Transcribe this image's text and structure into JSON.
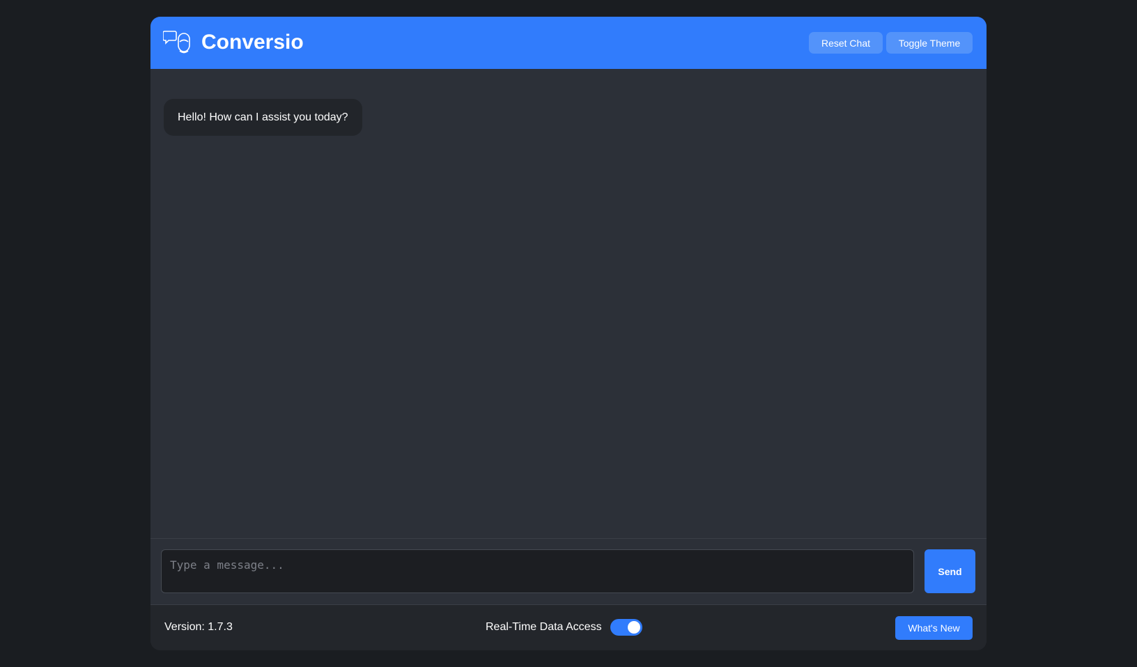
{
  "header": {
    "title": "Conversio",
    "logo_icon": "chat-faces-icon",
    "reset_label": "Reset Chat",
    "theme_label": "Toggle Theme"
  },
  "messages": [
    {
      "sender": "bot",
      "text": "Hello! How can I assist you today?"
    }
  ],
  "composer": {
    "placeholder": "Type a message...",
    "value": "",
    "send_label": "Send"
  },
  "footer": {
    "version_text": "Version: 1.7.3",
    "realtime_label": "Real-Time Data Access",
    "realtime_enabled": true,
    "whats_new_label": "What's New"
  },
  "colors": {
    "accent": "#317cfc",
    "page_bg": "#1a1d21",
    "panel_bg": "#2c3038",
    "bubble_bg": "#22252a"
  }
}
